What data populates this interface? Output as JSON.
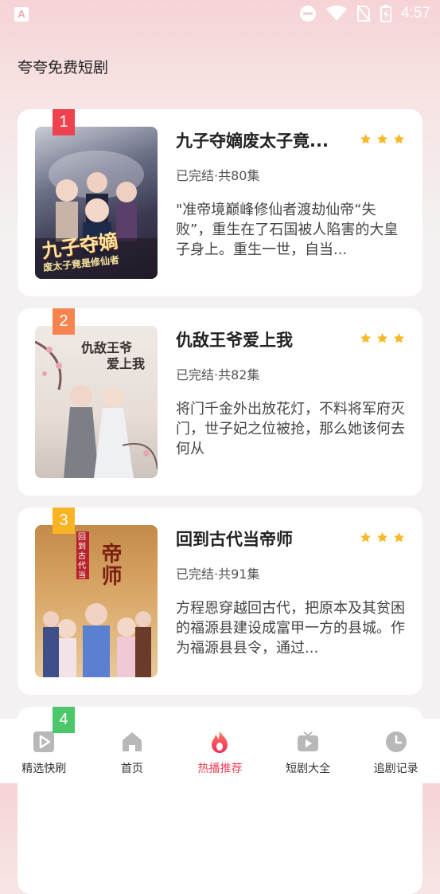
{
  "status": {
    "time": "4:57",
    "notification_letter": "A"
  },
  "page_title": "夸夸免费短剧",
  "dramas": [
    {
      "rank": "1",
      "title": "九子夺嫡废太子竟...",
      "meta": "已完结·共80集",
      "desc": "\"准帝境巅峰修仙者渡劫仙帝“失败”，重生在了石国被人陷害的大皇子身上。重生一世，自当...",
      "poster_text": "九子夺嫡",
      "poster_sub": "废太子竟是修仙者"
    },
    {
      "rank": "2",
      "title": "仇敌王爷爱上我",
      "meta": "已完结·共82集",
      "desc": "将门千金外出放花灯，不料将军府灭门，世子妃之位被抢，那么她该何去何从",
      "poster_text": "仇敌王爷",
      "poster_sub": "爱上我"
    },
    {
      "rank": "3",
      "title": "回到古代当帝师",
      "meta": "已完结·共91集",
      "desc": "方程恩穿越回古代，把原本及其贫困的福源县建设成富甲一方的县城。作为福源县县令，通过...",
      "poster_text": "帝师",
      "poster_sub": "回到古代当"
    },
    {
      "rank": "4"
    }
  ],
  "tabs": [
    {
      "label": "精选快刷",
      "icon": "play-square-icon"
    },
    {
      "label": "首页",
      "icon": "home-icon"
    },
    {
      "label": "热播推荐",
      "icon": "flame-icon",
      "active": true
    },
    {
      "label": "短剧大全",
      "icon": "tv-icon"
    },
    {
      "label": "追剧记录",
      "icon": "clock-icon"
    }
  ],
  "colors": {
    "accent": "#ef3f57",
    "star": "#f7b928",
    "rank1": "#f0424e",
    "rank2": "#f7834e",
    "rank3": "#f9b424",
    "rank4": "#4cc76a"
  }
}
